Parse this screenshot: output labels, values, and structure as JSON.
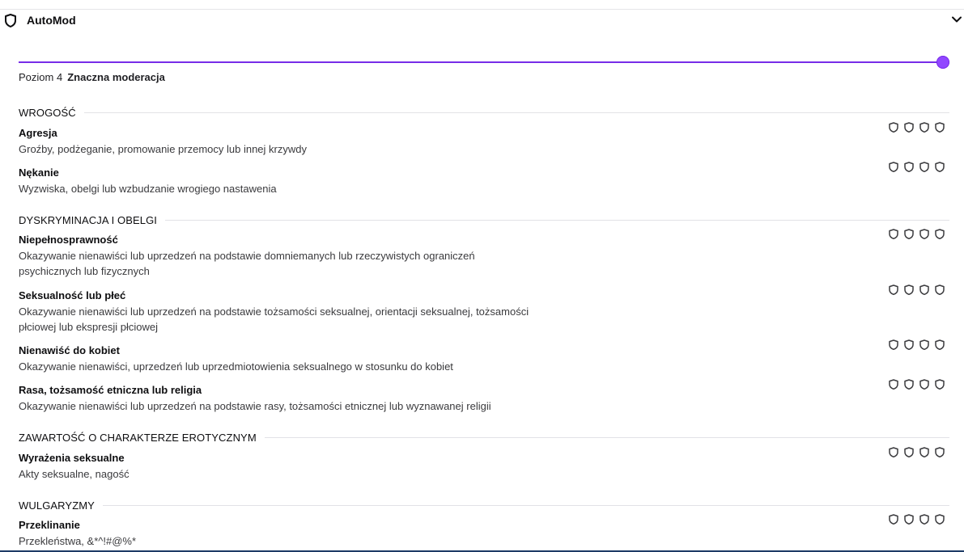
{
  "header": {
    "title": "AutoMod",
    "icon": "shield-icon",
    "toggle_icon": "chevron-down-icon"
  },
  "slider": {
    "level": 4,
    "max_level": 4,
    "accent": "#9147ff"
  },
  "level_label": {
    "prefix": "Poziom 4",
    "name": "Znaczna moderacja"
  },
  "sections": [
    {
      "title": "WROGOŚĆ",
      "items": [
        {
          "name": "Agresja",
          "desc": "Groźby, podżeganie, promowanie przemocy lub innej krzywdy"
        },
        {
          "name": "Nękanie",
          "desc": "Wyzwiska, obelgi lub wzbudzanie wrogiego nastawenia"
        }
      ]
    },
    {
      "title": "DYSKRYMINACJA I OBELGI",
      "items": [
        {
          "name": "Niepełnosprawność",
          "desc": "Okazywanie nienawiści lub uprzedzeń na podstawie domniemanych lub rzeczywistych ograniczeń psychicznych lub fizycznych"
        },
        {
          "name": "Seksualność lub płeć",
          "desc": "Okazywanie nienawiści lub uprzedzeń na podstawie tożsamości seksualnej, orientacji seksualnej, tożsamości płciowej lub ekspresji płciowej"
        },
        {
          "name": "Nienawiść do kobiet",
          "desc": "Okazywanie nienawiści, uprzedzeń lub uprzedmiotowienia seksualnego w stosunku do kobiet"
        },
        {
          "name": "Rasa, tożsamość etniczna lub religia",
          "desc": "Okazywanie nienawiści lub uprzedzeń na podstawie rasy, tożsamości etnicznej lub wyznawanej religii"
        }
      ]
    },
    {
      "title": "ZAWARTOŚĆ O CHARAKTERZE EROTYCZNYM",
      "items": [
        {
          "name": "Wyrażenia seksualne",
          "desc": "Akty seksualne, nagość"
        }
      ]
    },
    {
      "title": "WULGARYZMY",
      "items": [
        {
          "name": "Przeklinanie",
          "desc": "Przekleństwa, &*^!#@%*"
        }
      ]
    }
  ]
}
